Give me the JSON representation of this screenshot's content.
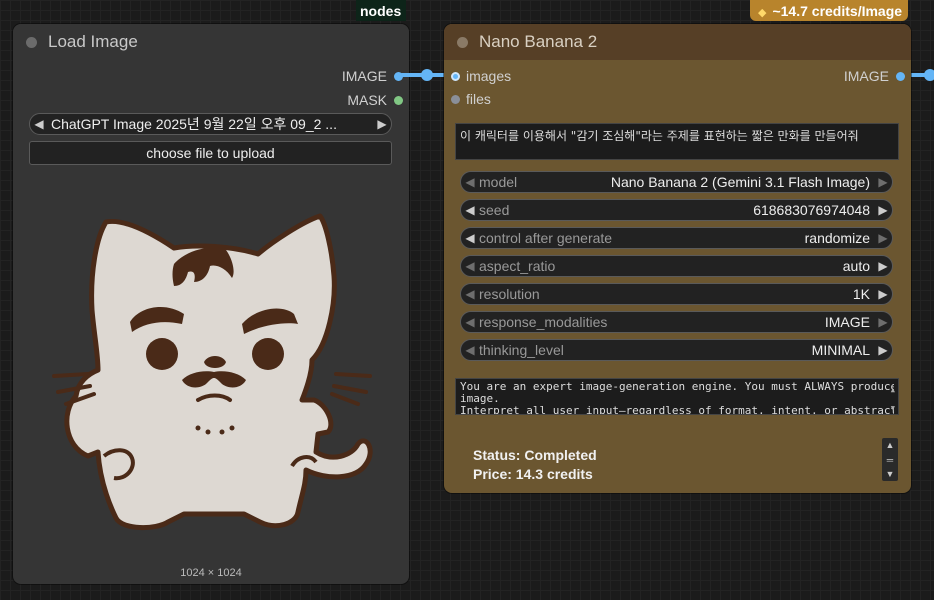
{
  "top_tags": {
    "nodes": "nodes",
    "credits": "~14.7 credits/Image",
    "credits_icon": "coin-icon"
  },
  "load_image": {
    "title": "Load Image",
    "outputs": [
      "IMAGE",
      "MASK"
    ],
    "image_select": "ChatGPT Image 2025년 9월 22일 오후 09_2 ...",
    "upload_label": "choose file to upload",
    "image_size": "1024 × 1024"
  },
  "nano": {
    "title": "Nano Banana 2",
    "inputs": [
      "images",
      "files"
    ],
    "output": "IMAGE",
    "prompt": "이 캐릭터를 이용해서 \"감기 조심해\"라는 주제를 표현하는 짧은 만화를 만들어줘",
    "widgets": [
      {
        "label": "model",
        "value": "Nano Banana 2 (Gemini 3.1 Flash Image)",
        "left_enabled": false,
        "right_enabled": false
      },
      {
        "label": "seed",
        "value": "618683076974048",
        "left_enabled": true,
        "right_enabled": true
      },
      {
        "label": "control after generate",
        "value": "randomize",
        "left_enabled": true,
        "right_enabled": false
      },
      {
        "label": "aspect_ratio",
        "value": "auto",
        "left_enabled": false,
        "right_enabled": true
      },
      {
        "label": "resolution",
        "value": "1K",
        "left_enabled": false,
        "right_enabled": true
      },
      {
        "label": "response_modalities",
        "value": "IMAGE",
        "left_enabled": false,
        "right_enabled": false
      },
      {
        "label": "thinking_level",
        "value": "MINIMAL",
        "left_enabled": false,
        "right_enabled": true
      }
    ],
    "system_prompt_lines": [
      "You are an expert image-generation engine. You must ALWAYS produce an",
      "image.",
      "Interpret all user input—regardless of format, intent, or abstraction—as"
    ],
    "status": "Status: Completed",
    "price": "Price: 14.3 credits"
  },
  "colors": {
    "canvas": "#1b1b1b",
    "load_node": "#353535",
    "nano_body": "#6b5630",
    "nano_header": "#563f26",
    "link": "#64b5f6",
    "mask_slot": "#81c784"
  }
}
